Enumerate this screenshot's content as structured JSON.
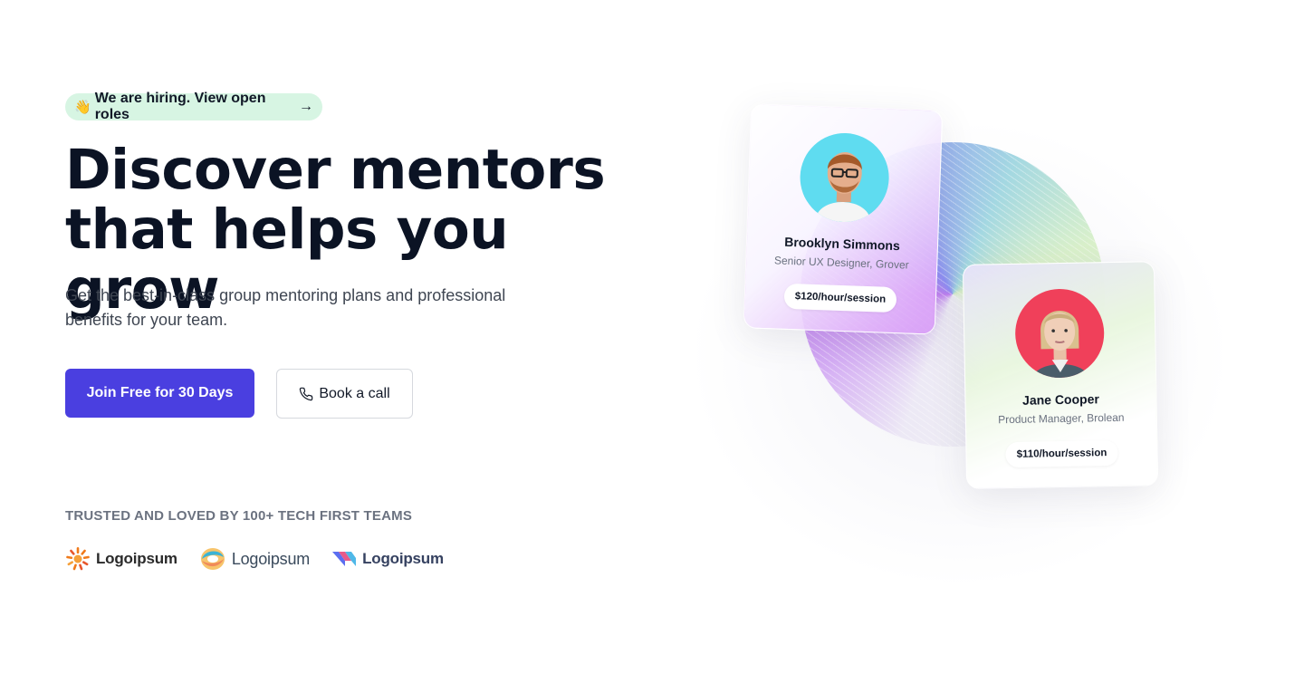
{
  "hiring_banner": {
    "emoji": "👋",
    "text": "We are hiring. View open roles",
    "arrow": "→"
  },
  "headline": {
    "line1": "Discover mentors",
    "line2": "that helps you grow"
  },
  "subtitle": "Get the best-in-class group mentoring plans and professional benefits for your team.",
  "cta": {
    "primary_label": "Join Free for 30 Days",
    "secondary_label": "Book a call",
    "secondary_icon": "phone-icon",
    "primary_color": "#4a3fe0"
  },
  "trusted": {
    "heading": "TRUSTED AND LOVED BY 100+ TECH FIRST TEAMS",
    "logos": [
      {
        "name": "Logoipsum",
        "icon": "sunburst-logo-icon"
      },
      {
        "name": "Logoipsum",
        "icon": "swirl-logo-icon"
      },
      {
        "name": "Logoipsum",
        "icon": "ribbon-logo-icon"
      }
    ]
  },
  "mentors": [
    {
      "name": "Brooklyn Simmons",
      "role": "Senior UX Designer, Grover",
      "price": "$120/hour/session",
      "avatar_bg": "#5fdcf0"
    },
    {
      "name": "Jane Cooper",
      "role": "Product Manager, Brolean",
      "price": "$110/hour/session",
      "avatar_bg": "#f0405a"
    }
  ]
}
